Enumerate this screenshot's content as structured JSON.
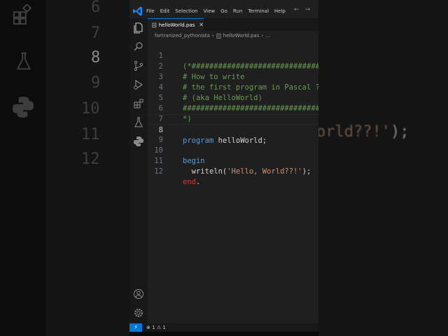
{
  "background": {
    "line_numbers": [
      "6",
      "7",
      "8",
      "9",
      "10",
      "11",
      "12"
    ],
    "code_fragment_text": "orld??!'",
    "code_fragment_tail": ");"
  },
  "menu": [
    "File",
    "Edit",
    "Selection",
    "View",
    "Go",
    "Run",
    "Terminal",
    "Help"
  ],
  "tab": {
    "label": "helloWorld.pas",
    "close": "✕"
  },
  "breadcrumb": {
    "folder": "fortranized_pythonista",
    "file": "helloWorld.pas",
    "more": "..."
  },
  "editor": {
    "active_line": 8,
    "lines": [
      {
        "n": "1",
        "code": "(*############################################"
      },
      {
        "n": "2",
        "code": "# How to write"
      },
      {
        "n": "3",
        "code": "# the first program in Pascal ?"
      },
      {
        "n": "4",
        "code": "# (aka HelloWorld)"
      },
      {
        "n": "5",
        "code": "############################################"
      },
      {
        "n": "6",
        "code": "*)"
      },
      {
        "n": "7",
        "code": ""
      },
      {
        "n": "8",
        "kw": "program",
        "rest": " helloWorld;"
      },
      {
        "n": "9",
        "code": ""
      },
      {
        "n": "10",
        "kw": "begin"
      },
      {
        "n": "11",
        "indent": "  ",
        "fn": "writeln(",
        "str": "'Hello, World??!'",
        "tail": ");"
      },
      {
        "n": "12",
        "kw": "end",
        "tail": "."
      }
    ]
  },
  "status": {
    "errors": "1",
    "warnings": "1"
  },
  "colors": {
    "accent": "#0078d4",
    "comment": "#6a9955",
    "keyword": "#569cd6",
    "string": "#ce9178",
    "end_keyword": "#d03a3a"
  }
}
